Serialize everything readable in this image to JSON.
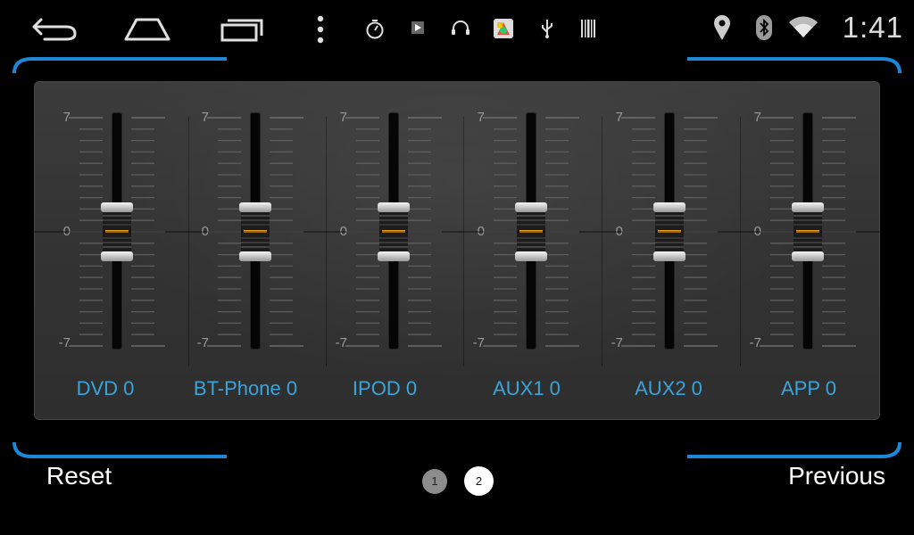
{
  "status_bar": {
    "time": "1:41",
    "icons": [
      "back-icon",
      "home-icon",
      "recent-apps-icon",
      "menu-icon",
      "timer-icon",
      "video-icon",
      "headset-icon",
      "app-icon",
      "usb-icon",
      "barcode-icon",
      "location-icon",
      "bluetooth-icon",
      "wifi-icon"
    ]
  },
  "equalizer": {
    "scale": {
      "max": "7",
      "mid": "0",
      "min": "-7"
    },
    "channels": [
      {
        "id": "dvd",
        "label": "DVD 0",
        "value": 0
      },
      {
        "id": "bt-phone",
        "label": "BT-Phone 0",
        "value": 0
      },
      {
        "id": "ipod",
        "label": "IPOD 0",
        "value": 0
      },
      {
        "id": "aux1",
        "label": "AUX1 0",
        "value": 0
      },
      {
        "id": "aux2",
        "label": "AUX2 0",
        "value": 0
      },
      {
        "id": "app",
        "label": "APP 0",
        "value": 0
      }
    ]
  },
  "footer": {
    "reset_label": "Reset",
    "previous_label": "Previous",
    "pages": [
      {
        "label": "1",
        "active": false
      },
      {
        "label": "2",
        "active": true
      }
    ]
  },
  "colors": {
    "accent": "#1e88d8",
    "label": "#3aa4db",
    "background": "#000000"
  }
}
